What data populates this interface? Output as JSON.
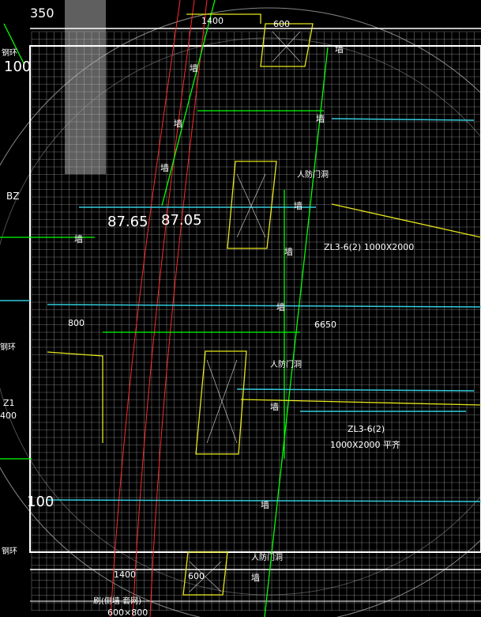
{
  "drawing": {
    "colors": {
      "background": "#000000",
      "grid": "#c8c8c8",
      "frame": "#ffffff",
      "column_line": "#00ff00",
      "rebar_red": "#ff2a2a",
      "cyan_line": "#33ccdd",
      "yellow_outline": "#e6e61a",
      "green_text": "#22ff22"
    },
    "labels": {
      "top_dim_1400": "1400",
      "top_dim_600": "600",
      "left_350": "350",
      "left_100": "100",
      "left_bz": "BZ",
      "elev_1": "87.65",
      "elev_2": "87.05",
      "door_1": "人防门洞",
      "beam_1": "ZL3-6(2) 1000X2000",
      "dim_800": "800",
      "dim_6650": "6650",
      "door_2": "人防门洞",
      "left_z1": "Z1",
      "left_400": "400",
      "beam_2": "ZL3-6(2)",
      "beam_2_size": "1000X2000 平齐",
      "left_100_b": "100",
      "bottom_dim_1400": "1400",
      "bottom_dim_600": "600",
      "door_3": "人防门洞",
      "bottom_note": "刷(侧墙 套网)",
      "bottom_dim_2": "600×800",
      "left_gangjin_1": "钢环",
      "left_gangjin_2": "钢环",
      "left_gangjin_3": "钢环"
    },
    "column_marks": [
      "墙",
      "墙",
      "墙",
      "墙",
      "墙",
      "墙",
      "墙",
      "墙",
      "墙",
      "墙",
      "墙",
      "墙"
    ]
  }
}
